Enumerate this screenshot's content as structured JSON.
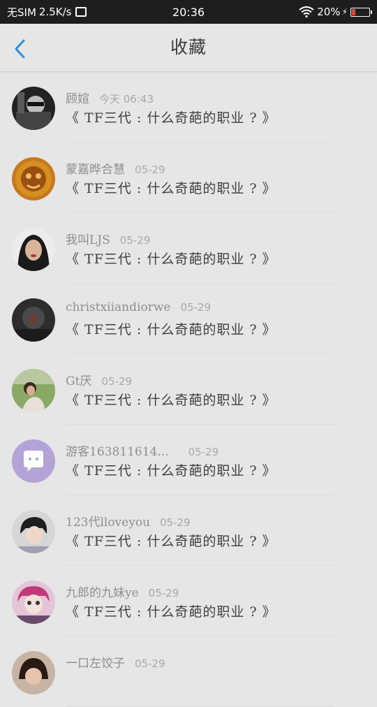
{
  "statusbar": {
    "carrier": "无SIM",
    "speed": "2.5K/s",
    "time": "20:36",
    "battery": "20%",
    "battery_level": 0.2
  },
  "header": {
    "title": "收藏",
    "back_icon": "chevron-left-icon",
    "accent": "#2f8fd8"
  },
  "items": [
    {
      "user": "顾媗",
      "time": "今天 06:43",
      "title": "《 TF三代 : 什么奇葩的职业 ? 》"
    },
    {
      "user": "蒙嘉晔合慧",
      "time": "05-29",
      "title": "《 TF三代 : 什么奇葩的职业 ? 》"
    },
    {
      "user": "我叫LJS",
      "time": "05-29",
      "title": "《 TF三代 : 什么奇葩的职业 ? 》"
    },
    {
      "user": "christxiiandiorwe",
      "time": "05-29",
      "title": "《 TF三代 : 什么奇葩的职业 ? 》"
    },
    {
      "user": "Gt厌",
      "time": "05-29",
      "title": "《 TF三代 : 什么奇葩的职业 ? 》"
    },
    {
      "user": "游客163811614...",
      "time": "05-29",
      "title": "《 TF三代 : 什么奇葩的职业 ? 》"
    },
    {
      "user": "123代lloveyou",
      "time": "05-29",
      "title": "《 TF三代 : 什么奇葩的职业 ? 》"
    },
    {
      "user": "九郎的九妹ye",
      "time": "05-29",
      "title": "《 TF三代 : 什么奇葩的职业 ? 》"
    },
    {
      "user": "一口左饺子",
      "time": "05-29",
      "title": ""
    }
  ]
}
